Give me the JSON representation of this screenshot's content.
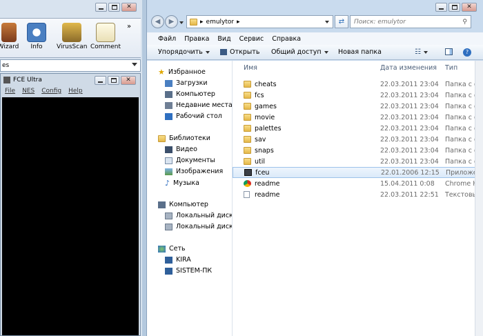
{
  "left_app": {
    "toolbar": [
      {
        "label": "Wizard",
        "icon": "wizard-icon"
      },
      {
        "label": "Info",
        "icon": "info-icon"
      },
      {
        "label": "VirusScan",
        "icon": "virusscan-icon"
      },
      {
        "label": "Comment",
        "icon": "comment-icon"
      }
    ],
    "overflow": "»",
    "combo_value": "es"
  },
  "fce": {
    "title": "FCE Ultra",
    "menu": [
      "File",
      "NES",
      "Config",
      "Help"
    ]
  },
  "explorer": {
    "address": {
      "crumb": "emulytor",
      "sep": "▸"
    },
    "search_placeholder": "Поиск: emulytor",
    "menu": [
      "Файл",
      "Правка",
      "Вид",
      "Сервис",
      "Справка"
    ],
    "commands": {
      "organize": "Упорядочить",
      "open": "Открыть",
      "share": "Общий доступ",
      "new_folder": "Новая папка"
    },
    "nav": {
      "favorites": "Избранное",
      "downloads": "Загрузки",
      "computer_fav": "Компьютер",
      "recent": "Недавние места",
      "desktop": "Рабочий стол",
      "libraries": "Библиотеки",
      "video": "Видео",
      "documents": "Документы",
      "images": "Изображения",
      "music": "Музыка",
      "computer": "Компьютер",
      "disk_c": "Локальный диск (C",
      "disk_d": "Локальный диск (D",
      "network": "Сеть",
      "net1": "KIRA",
      "net2": "SISTEM-ПК"
    },
    "columns": {
      "name": "Имя",
      "date": "Дата изменения",
      "type": "Тип"
    },
    "files": [
      {
        "name": "cheats",
        "date": "22.03.2011 23:04",
        "type": "Папка с фай",
        "kind": "folder"
      },
      {
        "name": "fcs",
        "date": "22.03.2011 23:04",
        "type": "Папка с фай",
        "kind": "folder"
      },
      {
        "name": "games",
        "date": "22.03.2011 23:04",
        "type": "Папка с фай",
        "kind": "folder"
      },
      {
        "name": "movie",
        "date": "22.03.2011 23:04",
        "type": "Папка с фай",
        "kind": "folder"
      },
      {
        "name": "palettes",
        "date": "22.03.2011 23:04",
        "type": "Папка с фай",
        "kind": "folder"
      },
      {
        "name": "sav",
        "date": "22.03.2011 23:04",
        "type": "Папка с фай",
        "kind": "folder"
      },
      {
        "name": "snaps",
        "date": "22.03.2011 23:04",
        "type": "Папка с фай",
        "kind": "folder"
      },
      {
        "name": "util",
        "date": "22.03.2011 23:04",
        "type": "Папка с фай",
        "kind": "folder"
      },
      {
        "name": "fceu",
        "date": "22.01.2006 12:15",
        "type": "Приложени",
        "kind": "app"
      },
      {
        "name": "readme",
        "date": "15.04.2011 0:08",
        "type": "Chrome HTM",
        "kind": "chrome"
      },
      {
        "name": "readme",
        "date": "22.03.2011 22:51",
        "type": "Текстовый д",
        "kind": "text"
      }
    ]
  }
}
